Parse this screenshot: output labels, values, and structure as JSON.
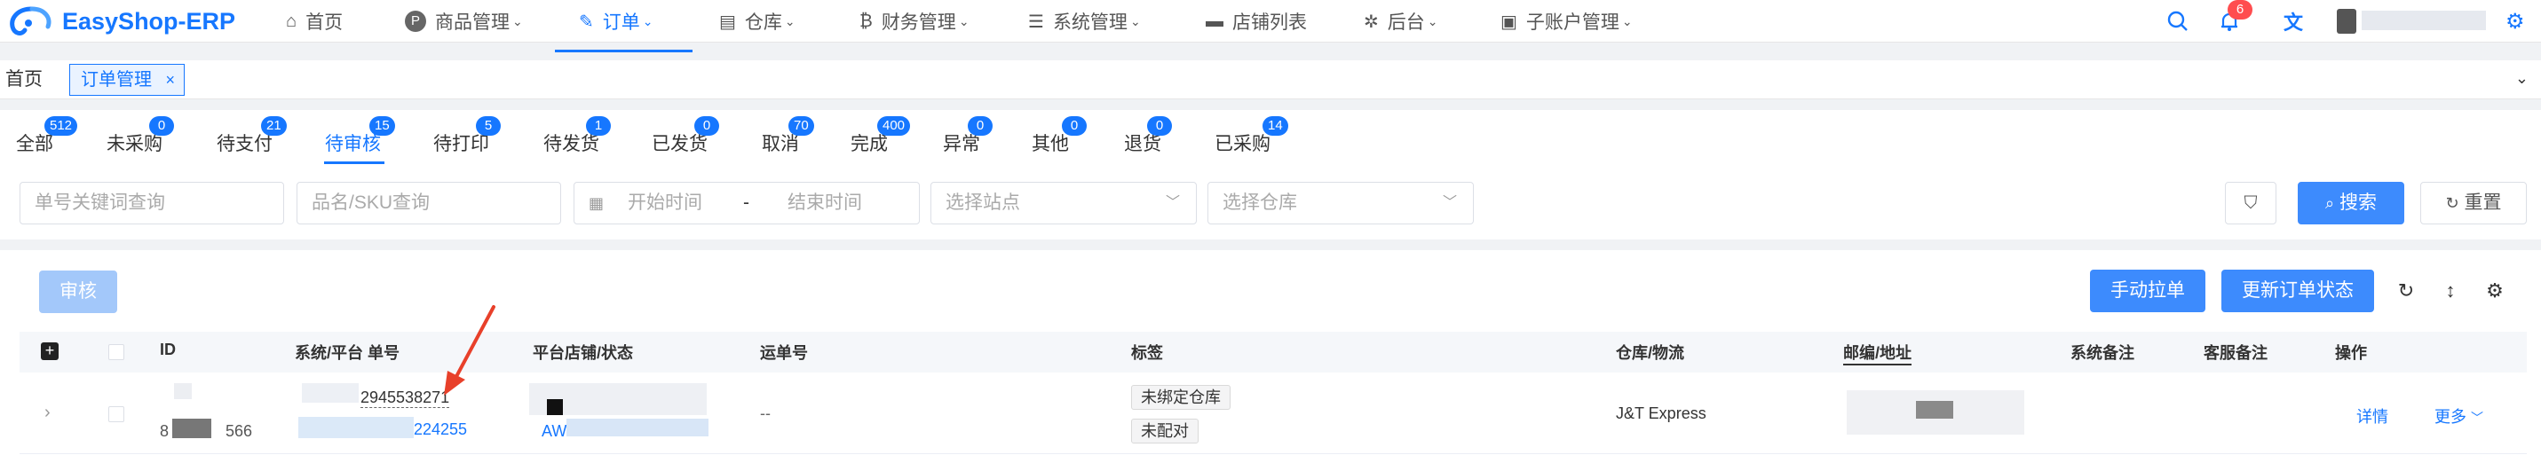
{
  "app": {
    "logo_text": "EasyShop-ERP"
  },
  "top_menu": [
    {
      "icon": "home-icon",
      "label": "首页"
    },
    {
      "icon": "product-icon",
      "label": "商品管理"
    },
    {
      "icon": "order-icon",
      "label": "订单"
    },
    {
      "icon": "warehouse-icon",
      "label": "仓库"
    },
    {
      "icon": "finance-icon",
      "label": "财务管理"
    },
    {
      "icon": "settings-icon",
      "label": "系统管理"
    },
    {
      "icon": "shop-icon",
      "label": "店铺列表"
    },
    {
      "icon": "bug-icon",
      "label": "后台"
    },
    {
      "icon": "subaccount-icon",
      "label": "子账户管理"
    }
  ],
  "header_right": {
    "notification_count": "6"
  },
  "tabs": {
    "home": "首页",
    "orders": "订单管理",
    "close": "×"
  },
  "status_tabs": [
    {
      "label": "全部",
      "count": "512"
    },
    {
      "label": "未采购",
      "count": "0"
    },
    {
      "label": "待支付",
      "count": "21"
    },
    {
      "label": "待审核",
      "count": "15"
    },
    {
      "label": "待打印",
      "count": "5"
    },
    {
      "label": "待发货",
      "count": "1"
    },
    {
      "label": "已发货",
      "count": "0"
    },
    {
      "label": "取消",
      "count": "70"
    },
    {
      "label": "完成",
      "count": "400"
    },
    {
      "label": "异常",
      "count": "0"
    },
    {
      "label": "其他",
      "count": "0"
    },
    {
      "label": "退货",
      "count": "0"
    },
    {
      "label": "已采购",
      "count": "14"
    }
  ],
  "filters": {
    "order_keyword_placeholder": "单号关键词查询",
    "sku_placeholder": "品名/SKU查询",
    "start_time_placeholder": "开始时间",
    "date_separator": "-",
    "end_time_placeholder": "结束时间",
    "site_placeholder": "选择站点",
    "warehouse_placeholder": "选择仓库",
    "search_label": "搜索",
    "reset_label": "重置"
  },
  "toolbar": {
    "approve_label": "审核",
    "manual_pull_label": "手动拉单",
    "update_status_label": "更新订单状态"
  },
  "table": {
    "columns": [
      "ID",
      "系统/平台 单号",
      "平台店铺/状态",
      "运单号",
      "标签",
      "仓库/物流",
      "邮编/地址",
      "系统备注",
      "客服备注",
      "操作"
    ],
    "rows": [
      {
        "id_suffix": "566",
        "id_prefix": "8",
        "system_no_suffix": "2945538271",
        "platform_no_suffix": "224255",
        "shop_prefix": "AW",
        "tracking_no": "--",
        "tags": [
          "未绑定仓库",
          "未配对"
        ],
        "logistics": "J&T Express",
        "actions": {
          "detail": "详情",
          "more": "更多"
        }
      }
    ]
  },
  "colors": {
    "primary": "#1677ff",
    "danger": "#ff4d4f",
    "annotation_arrow": "#e8402a"
  }
}
